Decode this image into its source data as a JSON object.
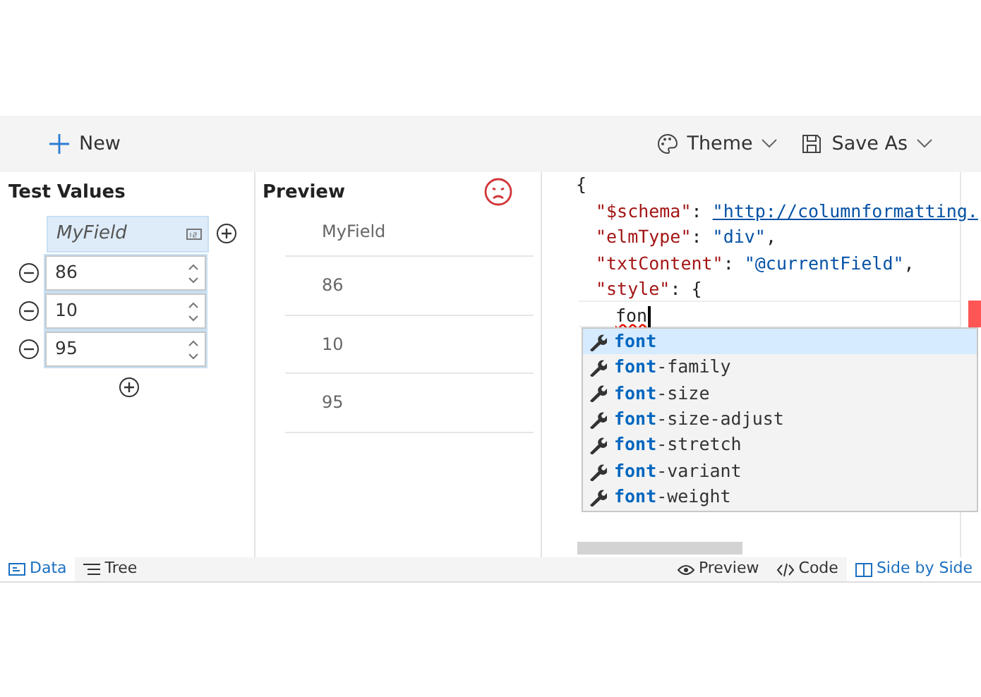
{
  "toolbar": {
    "new_label": "New",
    "theme_label": "Theme",
    "save_label": "Save As"
  },
  "test_values": {
    "title": "Test Values",
    "field": "MyField",
    "values": [
      "86",
      "10",
      "95"
    ]
  },
  "preview": {
    "title": "Preview",
    "valid": false,
    "header": "MyField",
    "rows": [
      "86",
      "10",
      "95"
    ]
  },
  "code": {
    "lines": [
      [
        {
          "kind": "punct",
          "text": "{"
        }
      ],
      [
        {
          "kind": "key",
          "text": "\"$schema\""
        },
        {
          "kind": "punct",
          "text": ": "
        },
        {
          "kind": "link",
          "text": "\"http://columnformatting."
        }
      ],
      [
        {
          "kind": "key",
          "text": "\"elmType\""
        },
        {
          "kind": "punct",
          "text": ": "
        },
        {
          "kind": "string",
          "text": "\"div\""
        },
        {
          "kind": "punct",
          "text": ","
        }
      ],
      [
        {
          "kind": "key",
          "text": "\"txtContent\""
        },
        {
          "kind": "punct",
          "text": ": "
        },
        {
          "kind": "string",
          "text": "\"@currentField\""
        },
        {
          "kind": "punct",
          "text": ","
        }
      ],
      [
        {
          "kind": "key",
          "text": "\"style\""
        },
        {
          "kind": "punct",
          "text": ": {"
        }
      ],
      [
        {
          "kind": "error",
          "text": "fon"
        }
      ]
    ],
    "suggestions": [
      {
        "match": "font",
        "selected": true
      },
      {
        "match": "font",
        "rest": "-family",
        "selected": false
      },
      {
        "match": "font",
        "rest": "-size",
        "selected": false
      },
      {
        "match": "font",
        "rest": "-size-adjust",
        "selected": false
      },
      {
        "match": "font",
        "rest": "-stretch",
        "selected": false
      },
      {
        "match": "font",
        "rest": "-variant",
        "selected": false
      },
      {
        "match": "font",
        "rest": "-weight",
        "selected": false
      }
    ]
  },
  "left_tabs": [
    {
      "label": "Data",
      "selected": true
    },
    {
      "label": "Tree",
      "selected": false
    }
  ],
  "view_tabs": [
    {
      "label": "Preview",
      "selected": false
    },
    {
      "label": "Code",
      "selected": false
    },
    {
      "label": "Side by Side",
      "selected": true
    }
  ]
}
